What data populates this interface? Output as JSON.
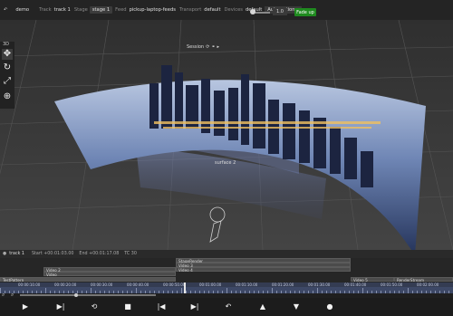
{
  "topbar": {
    "back_icon": "back-icon",
    "project": "demo",
    "track_label": "Track",
    "track_value": "track 1",
    "stage_label": "Stage",
    "stage_value": "stage 1",
    "feed_label": "Feed",
    "feed_value": "pickup-laptop-feeds",
    "transport_label": "Transport",
    "transport_value": "default",
    "devices_label": "Devices",
    "devices_value": "default",
    "automation_label": "Automation",
    "value1": "1.0",
    "value2": "1.0",
    "fade_button": "Fade up"
  },
  "tools": [
    "move-icon",
    "rotate-icon",
    "scale-icon",
    "globe-icon"
  ],
  "view_label": "3D",
  "session": {
    "label": "Session"
  },
  "surface_label": "surface 2",
  "track_info": {
    "track": "track 1",
    "start": "Start +00:01:03.00",
    "end": "End +00:01:17.08",
    "tc": "TC 30"
  },
  "clips": [
    {
      "label": "StageRender"
    },
    {
      "label": "Video 3"
    },
    {
      "label": "Video 4"
    },
    {
      "label": "Video 2"
    },
    {
      "label": "Video"
    },
    {
      "label": "TestPattern"
    },
    {
      "label": "Video 5"
    },
    {
      "label": "RenderStream"
    }
  ],
  "ruler_labels": [
    "00:00:10.00",
    "00:00:20.00",
    "00:00:30.00",
    "00:00:40.00",
    "00:00:50.00",
    "00:01:00.00",
    "00:01:10.00",
    "00:01:20.00",
    "00:01:30.00",
    "00:01:40.00",
    "00:01:50.00",
    "00:02:00.00"
  ],
  "transport_icons": [
    "play-icon",
    "play-to-end-icon",
    "loop-icon",
    "stop-icon",
    "previous-icon",
    "next-icon",
    "undo-icon",
    "up-icon",
    "down-icon",
    "record-icon"
  ],
  "colors": {
    "accent": "#1f8a1f",
    "ruler": "#3d4866",
    "background": "#2b2b2b"
  }
}
